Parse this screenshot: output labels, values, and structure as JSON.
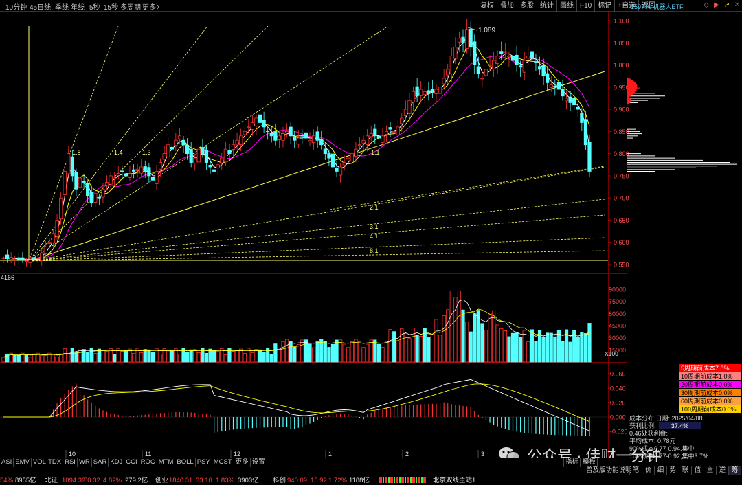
{
  "topbar": {
    "periods": [
      "10分钟",
      "45日线",
      "季线",
      "年线",
      "5秒",
      "15秒",
      "多周期",
      "更多〉"
    ],
    "right_buttons": [
      "复权",
      "叠加",
      "多股",
      "统计",
      "画线",
      "F10",
      "标记",
      "+自选",
      "返回"
    ],
    "instrument": "159770 机器人ETF"
  },
  "main_chart": {
    "y_ticks": [
      "1.100",
      "1.050",
      "1.000",
      "0.950",
      "0.900",
      "0.850",
      "0.800",
      "0.750",
      "0.700",
      "0.650",
      "0.600",
      "0.550"
    ],
    "high_label": "1.089",
    "fan_labels": [
      "1.8",
      "1.4",
      "1.3",
      "1.2",
      "1.1",
      "2.1",
      "3.1",
      "4.1",
      "8.1"
    ]
  },
  "volume_chart": {
    "left_label": "4166",
    "y_ticks": [
      "90000",
      "75000",
      "60000",
      "45000",
      "30000",
      "15000"
    ],
    "unit": "X100"
  },
  "macd_chart": {
    "y_ticks": [
      "0.060",
      "0.040",
      "0.020",
      "0.000",
      "-0.020"
    ],
    "month_labels": [
      "10",
      "11",
      "12",
      "1",
      "2",
      "3"
    ]
  },
  "cost_legend": [
    {
      "label": "5周期前成本7.8%",
      "color": "#ff0000"
    },
    {
      "label": "10周期前成本1.0%",
      "color": "#ff8080"
    },
    {
      "label": "20周期前成本0.0%",
      "color": "#ff00ff"
    },
    {
      "label": "30周期前成本0.0%",
      "color": "#ff8000"
    },
    {
      "label": "60周期前成本0.0%",
      "color": "#ffa040"
    },
    {
      "label": "100周期前成本0.0%",
      "color": "#ffd000"
    }
  ],
  "cost_panel": {
    "date_line": "成本分布,日期: 2025/04/08",
    "profit_label": "获利比例:",
    "profit_value": "37.4%",
    "profit_price": "0.46处获利盘:",
    "avg_cost": "平均成本: 0.78元",
    "range1": "90%成本0.77-0.94,集中",
    "range2": "70%成本0.77-0.92,集中3.7%"
  },
  "indicator_tabs": [
    "ASI",
    "EMV",
    "VOL-TDX",
    "RSI",
    "WR",
    "SAR",
    "KDJ",
    "CCI",
    "ROC",
    "MTM",
    "BOLL",
    "PSY",
    "MCST",
    "更多",
    "设置"
  ],
  "model_tabs": [
    "指标",
    "模板"
  ],
  "bottom_right_text": "普及版功能说明",
  "side_tabs": [
    "笔",
    "价",
    "细",
    "势",
    "联",
    "值",
    "主",
    "逆",
    "筹"
  ],
  "statusbar": {
    "s1_pct": "54%",
    "s1_amt": "8955亿",
    "beizheng_label": "北证",
    "beizheng_val": "1094.39",
    "beizheng_chg": "50.32",
    "beizheng_pct": "4.82%",
    "beizheng_amt": "279.2亿",
    "chuangye_label": "创业",
    "chuangye_val": "1840.31",
    "chuangye_chg": "33.10",
    "chuangye_pct": "1.83%",
    "chuangye_amt": "3903亿",
    "kechuang_label": "科创",
    "kechuang_val": "940.09",
    "kechuang_chg": "15.92",
    "kechuang_pct": "1.72%",
    "kechuang_amt": "1188亿",
    "server": "北京双线主站1"
  },
  "watermark": "公众号 · 佳财一分钟",
  "colors": {
    "up": "#ff3232",
    "down": "#54ffff",
    "ma5": "#ffffff",
    "ma10": "#ffff00",
    "ma20": "#ff00ff",
    "fan": "#ffff60"
  }
}
